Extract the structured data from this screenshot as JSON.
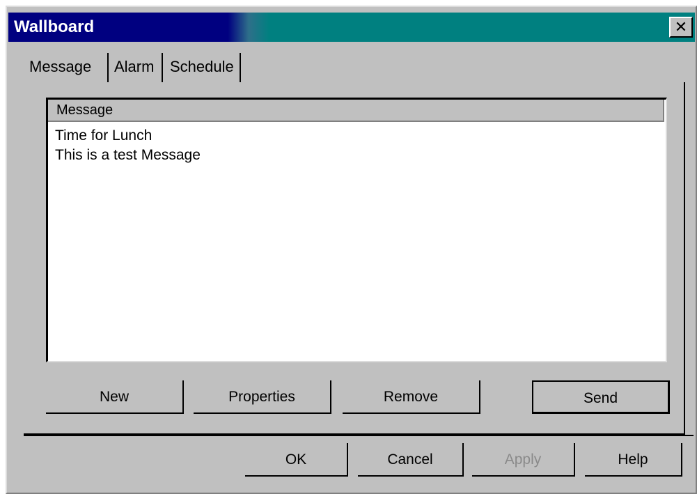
{
  "window": {
    "title": "Wallboard",
    "close_label": "✕"
  },
  "tabs": [
    {
      "label": "Message",
      "active": true
    },
    {
      "label": "Alarm",
      "active": false
    },
    {
      "label": "Schedule",
      "active": false
    }
  ],
  "message_list": {
    "column_header": "Message",
    "items": [
      "Time for Lunch",
      "This is a test Message"
    ]
  },
  "panel_buttons": {
    "new": "New",
    "properties": "Properties",
    "remove": "Remove",
    "send": "Send"
  },
  "dialog_buttons": {
    "ok": "OK",
    "cancel": "Cancel",
    "apply": "Apply",
    "help": "Help"
  },
  "colors": {
    "titlebar_active": "#000080",
    "titlebar_gradient_end": "#008080",
    "face": "#c0c0c0"
  }
}
